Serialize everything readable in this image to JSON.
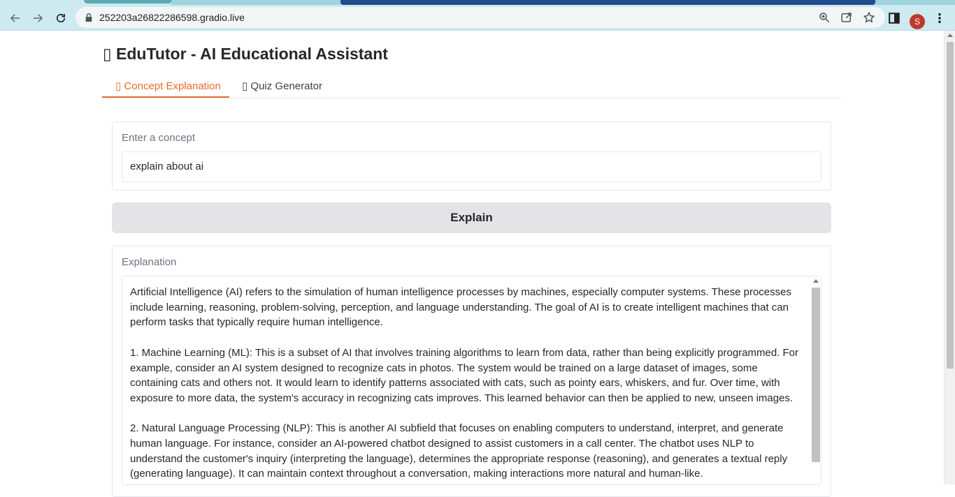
{
  "browser": {
    "url": "252203a26822286598.gradio.live",
    "profile_initial": "S"
  },
  "app": {
    "title": "▯ EduTutor - AI Educational Assistant",
    "tabs": [
      {
        "label": "▯ Concept Explanation",
        "active": true
      },
      {
        "label": "▯ Quiz Generator",
        "active": false
      }
    ],
    "concept_input": {
      "label": "Enter a concept",
      "value": "explain about ai"
    },
    "explain_button": "Explain",
    "explanation": {
      "label": "Explanation",
      "paragraphs": [
        "Artificial Intelligence (AI) refers to the simulation of human intelligence processes by machines, especially computer systems. These processes include learning, reasoning, problem-solving, perception, and language understanding. The goal of AI is to create intelligent machines that can perform tasks that typically require human intelligence.",
        "1. Machine Learning (ML): This is a subset of AI that involves training algorithms to learn from data, rather than being explicitly programmed. For example, consider an AI system designed to recognize cats in photos. The system would be trained on a large dataset of images, some containing cats and others not. It would learn to identify patterns associated with cats, such as pointy ears, whiskers, and fur. Over time, with exposure to more data, the system's accuracy in recognizing cats improves. This learned behavior can then be applied to new, unseen images.",
        "2. Natural Language Processing (NLP): This is another AI subfield that focuses on enabling computers to understand, interpret, and generate human language. For instance, consider an AI-powered chatbot designed to assist customers in a call center. The chatbot uses NLP to understand the customer's inquiry (interpreting the language), determines the appropriate response (reasoning), and generates a textual reply (generating language). It can maintain context throughout a conversation, making interactions more natural and human-like."
      ]
    }
  },
  "colors": {
    "accent": "#ea6a2a",
    "button_bg": "#e4e4e7",
    "chrome_bg": "#cdeaf1"
  }
}
